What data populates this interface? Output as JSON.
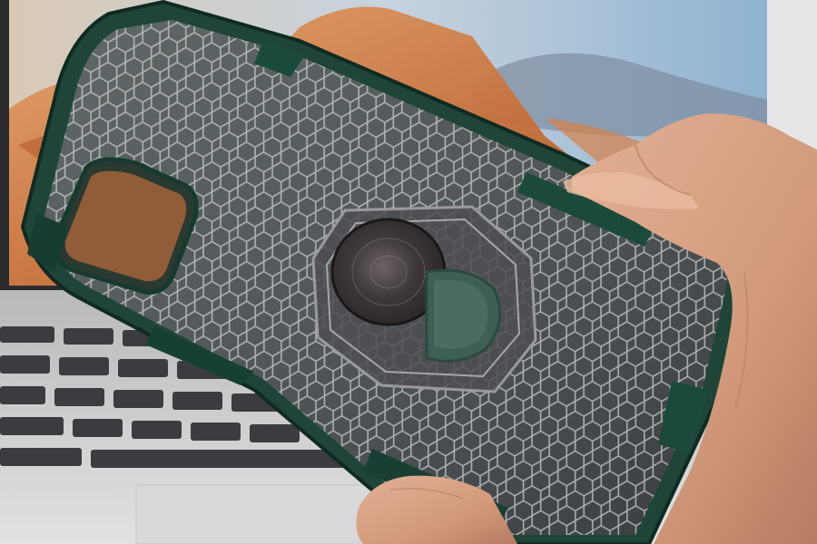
{
  "photo": {
    "subject": "phone-case-with-ring-holder",
    "colors": {
      "case_bumper": "#1f4a3c",
      "case_bumper_dark": "#123028",
      "case_back_tint": "#55555a",
      "hex_pattern_line": "#c9c9c9",
      "ring_disc": "#3a3436",
      "ring_rim": "#2a5a4c",
      "skin": "#d9a689",
      "skin_shadow": "#b98268",
      "laptop_body": "#c9c9cc",
      "laptop_screen_sky": "#a9c7df",
      "laptop_screen_rock": "#c97844",
      "keyboard_keys": "#3a3a3d"
    }
  }
}
